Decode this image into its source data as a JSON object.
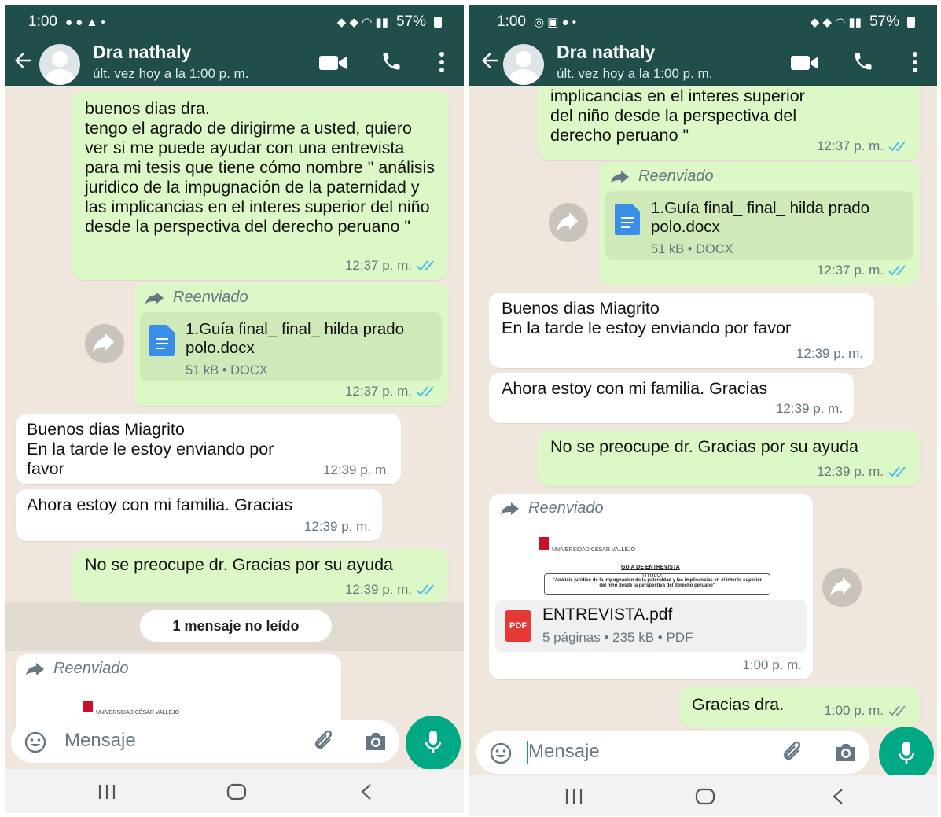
{
  "status": {
    "time": "1:00",
    "battery": "57%"
  },
  "contact": {
    "name": "Dra nathaly",
    "last_seen": "últ. vez hoy a la 1:00 p. m."
  },
  "messages": {
    "m1_text": "buenos dias dra.\ntengo el agrado de dirigirme a usted, quiero  ver si me puede ayudar con una entrevista para mi tesis que tiene cómo nombre \" análisis juridico de la impugnación de la paternidad y las implicancias en el interes superior del niño  desde la perspectiva del derecho peruano \"",
    "m1_tail": "implicancias en el interes superior\ndel niño  desde la perspectiva del\nderecho peruano \"",
    "m1_time": "12:37 p. m.",
    "forwarded": "Reenviado",
    "doc_name": "1.Guía final_ final_ hilda prado polo.docx",
    "doc_info": "51 kB • DOCX",
    "m2_time": "12:37 p. m.",
    "m3_text": "Buenos dias Miagrito\nEn la tarde le estoy enviando por favor",
    "m3_time": "12:39 p. m.",
    "m4_text": "Ahora estoy con mi familia. Gracias",
    "m4_time": "12:39 p. m.",
    "m5_text": "No se preocupe dr. Gracias por su ayuda",
    "m5_time": "12:39 p. m.",
    "unread": "1 mensaje no leído",
    "pdf_university": "Universidad César Vallejo",
    "pdf_heading": "GUÍA DE ENTREVISTA",
    "pdf_subheading": "TÍTULO:",
    "pdf_title_text": "\"Análisis jurídico de la impugnación de la paternidad y las implicancias en el interés superior del niño desde la perspectiva del derecho peruano\"",
    "pdf_badge": "PDF",
    "pdf_name": "ENTREVISTA.pdf",
    "pdf_info": "5 páginas • 235 kB • PDF",
    "m6_time": "1:00 p. m.",
    "m7_text": "Gracias dra.",
    "m7_time": "1:00 p. m."
  },
  "input": {
    "placeholder": "Mensaje"
  },
  "colors": {
    "header": "#1f4e4b",
    "outgoing": "#dcf8c6",
    "incoming": "#ffffff",
    "accent": "#00a884",
    "read_tick": "#53bdeb"
  },
  "icons": [
    "back-arrow-icon",
    "video-call-icon",
    "phone-call-icon",
    "more-options-icon",
    "forward-icon",
    "document-icon",
    "pdf-icon",
    "emoji-icon",
    "attach-icon",
    "camera-icon",
    "mic-icon",
    "double-tick-icon"
  ]
}
